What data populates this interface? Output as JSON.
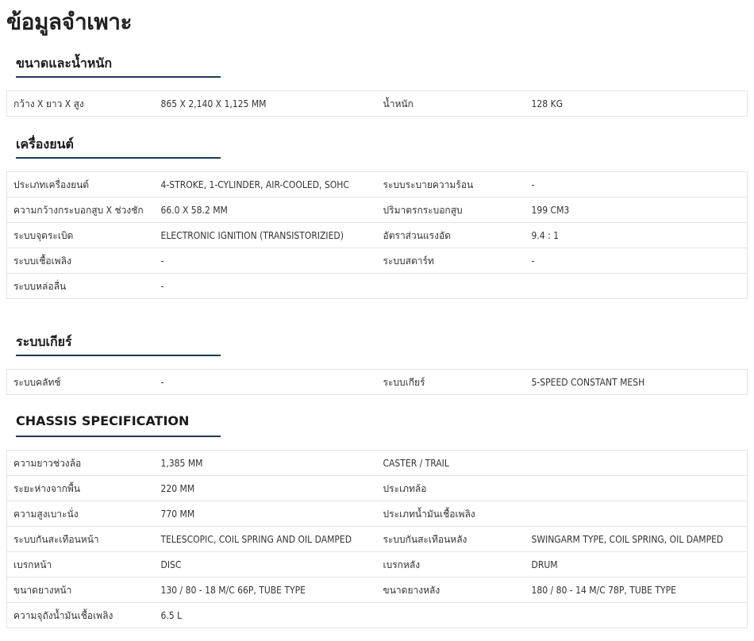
{
  "page": {
    "title": "ข้อมูลจำเพาะ"
  },
  "sections": [
    {
      "title": "ขนาดและน้ำหนัก",
      "rows": [
        [
          "กว้าง X ยาว X สูง",
          "865 X 2,140 X 1,125 MM",
          "น้ำหนัก",
          "128 KG"
        ]
      ]
    },
    {
      "title": "เครื่องยนต์",
      "rows": [
        [
          "ประเภทเครื่องยนต์",
          "4-STROKE, 1-CYLINDER, AIR-COOLED, SOHC",
          "ระบบระบายความร้อน",
          "-"
        ],
        [
          "ความกว้างกระบอกสูบ X ช่วงชัก",
          "66.0 X 58.2 MM",
          "ปริมาตรกระบอกสูบ",
          "199 CM3"
        ],
        [
          "ระบบจุดระเบิด",
          "ELECTRONIC IGNITION (TRANSISTORIZIED)",
          "อัตราส่วนแรงอัด",
          "9.4 : 1"
        ],
        [
          "ระบบเชื้อเพลิง",
          "-",
          "ระบบสตาร์ท",
          "-"
        ],
        [
          "ระบบหล่อลื่น",
          "-",
          "",
          ""
        ]
      ]
    },
    {
      "title": "ระบบเกียร์",
      "rows": [
        [
          "ระบบคลัทช์",
          "-",
          "ระบบเกียร์",
          "5-SPEED CONSTANT MESH"
        ]
      ]
    },
    {
      "title": "CHASSIS SPECIFICATION",
      "rows": [
        [
          "ความยาวช่วงล้อ",
          "1,385 MM",
          "CASTER / TRAIL",
          ""
        ],
        [
          "ระยะห่างจากพื้น",
          "220 MM",
          "ประเภทล้อ",
          ""
        ],
        [
          "ความสูงเบาะนั่ง",
          "770 MM",
          "ประเภทน้ำมันเชื้อเพลิง",
          ""
        ],
        [
          "ระบบกันสะเทือนหน้า",
          "TELESCOPIC, COIL SPRING AND OIL DAMPED",
          "ระบบกันสะเทือนหลัง",
          "SWINGARM TYPE, COIL SPRING, OIL DAMPED"
        ],
        [
          "เบรกหน้า",
          "DISC",
          "เบรกหลัง",
          "DRUM"
        ],
        [
          "ขนาดยางหน้า",
          "130 / 80 - 18 M/C 66P, TUBE TYPE",
          "ขนาดยางหลัง",
          "180 / 80 - 14 M/C 78P, TUBE TYPE"
        ],
        [
          "ความจุถังน้ำมันเชื้อเพลิง",
          "6.5 L",
          "",
          ""
        ]
      ]
    }
  ]
}
